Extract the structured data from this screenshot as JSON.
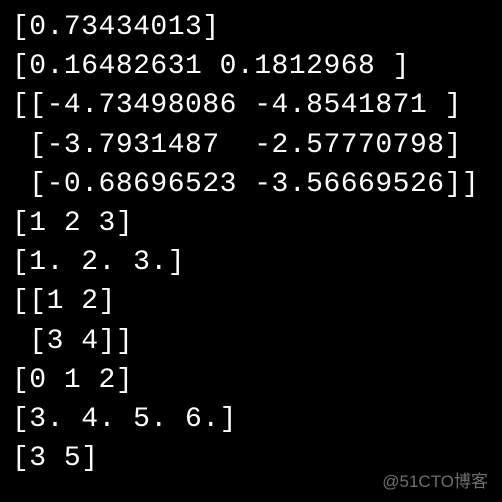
{
  "terminal": {
    "lines": [
      "[0.73434013]",
      "[0.16482631 0.1812968 ]",
      "[[-4.73498086 -4.8541871 ]",
      " [-3.7931487  -2.57770798]",
      " [-0.68696523 -3.56669526]]",
      "[1 2 3]",
      "[1. 2. 3.]",
      "[[1 2]",
      " [3 4]]",
      "[0 1 2]",
      "[3. 4. 5. 6.]",
      "[3 5]"
    ]
  },
  "watermark": "@51CTO博客"
}
